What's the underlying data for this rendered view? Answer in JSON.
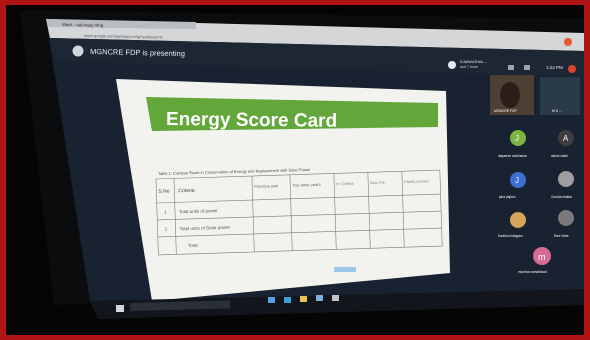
{
  "browser": {
    "tab_title": "Meet - rad-wacj-mhg",
    "url": "meet.google.com/rad-wacj-mhg?authuser=0"
  },
  "meet": {
    "presenter_banner": "MGNCRE FDP is presenting",
    "presenter_badge_name": "KJANAGHAL...",
    "presenter_badge_sub": "and 7 more",
    "clock": "1:24 PM",
    "participants": [
      {
        "name": "MGNCRE FDP",
        "initial": ""
      },
      {
        "name": "M S ...",
        "initial": ""
      },
      {
        "name": "dayasree ravicharan",
        "initial": "J"
      },
      {
        "name": "ashok vashi",
        "initial": "A"
      },
      {
        "name": "jaba pajhan",
        "initial": "J"
      },
      {
        "name": "Goutha khattar",
        "initial": ""
      },
      {
        "name": "Kavitha Indiagam",
        "initial": ""
      },
      {
        "name": "Ravi Varte",
        "initial": ""
      },
      {
        "name": "muchha namalhavat",
        "initial": "m"
      }
    ]
  },
  "slide": {
    "title": "Energy Score Card",
    "table_caption": "Table 1: Campus Score in Conservation of Energy and Replacement with Solar Power",
    "headers": [
      "S.No",
      "Criteria",
      "Previous year",
      "Two other years",
      "In Criteria",
      "Max Pts",
      "Points scored"
    ],
    "rows": [
      {
        "num": "1",
        "criteria": "Total units of power"
      },
      {
        "num": "2",
        "criteria": "Total units of Solar power"
      },
      {
        "num": "",
        "criteria": "Total"
      }
    ]
  },
  "colors": {
    "frame": "#b01414",
    "slide_title_bar": "#63a63a",
    "browser_bar": "#d4d6d8",
    "meet_dark": "#1b2530"
  }
}
